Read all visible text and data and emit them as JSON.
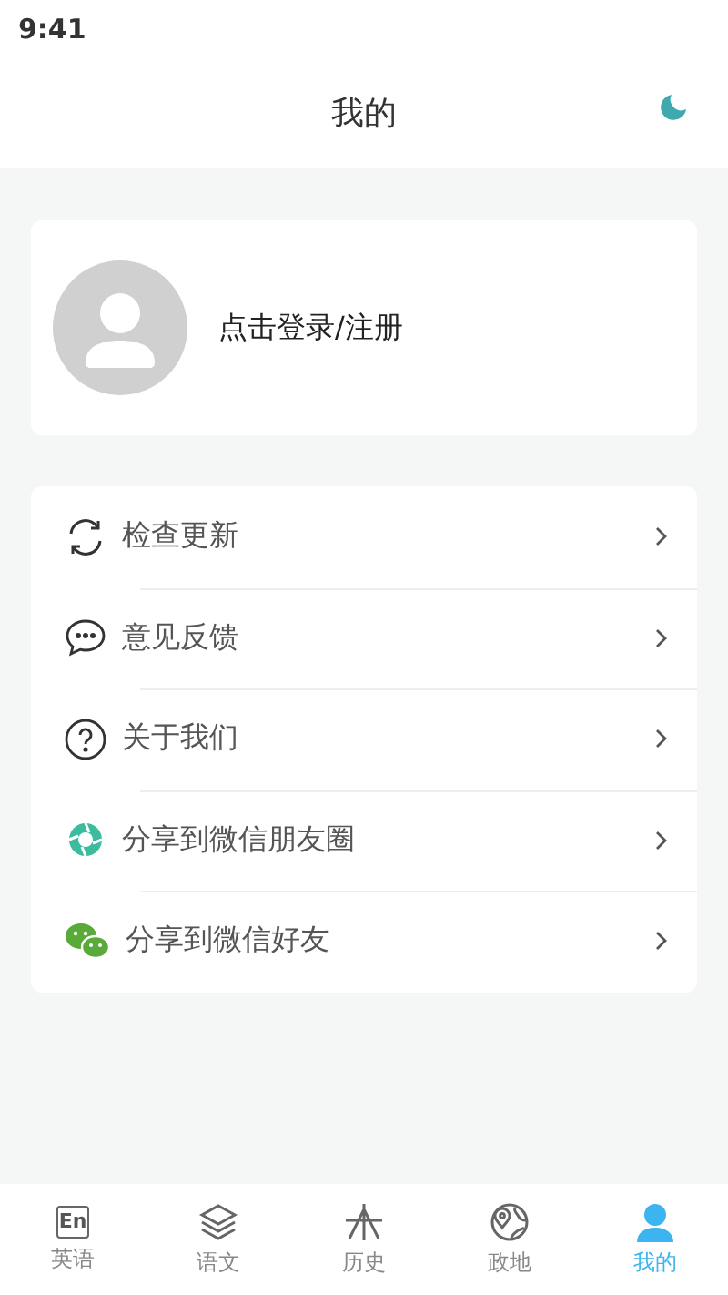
{
  "status_bar": {
    "time": "9:41"
  },
  "header": {
    "title": "我的"
  },
  "profile": {
    "login_text": "点击登录/注册"
  },
  "menu": [
    {
      "kind": "sync",
      "label": "检查更新"
    },
    {
      "kind": "chat",
      "label": "意见反馈"
    },
    {
      "kind": "help",
      "label": "关于我们"
    },
    {
      "kind": "moments",
      "label": "分享到微信朋友圈"
    },
    {
      "kind": "wechat",
      "label": "分享到微信好友"
    }
  ],
  "tabs": [
    {
      "kind": "english",
      "icon_text": "En",
      "label": "英语",
      "selected": false
    },
    {
      "kind": "layers",
      "label": "语文",
      "selected": false
    },
    {
      "kind": "history",
      "label": "历史",
      "selected": false
    },
    {
      "kind": "globe",
      "label": "政地",
      "selected": false
    },
    {
      "kind": "person",
      "label": "我的",
      "selected": true
    }
  ]
}
